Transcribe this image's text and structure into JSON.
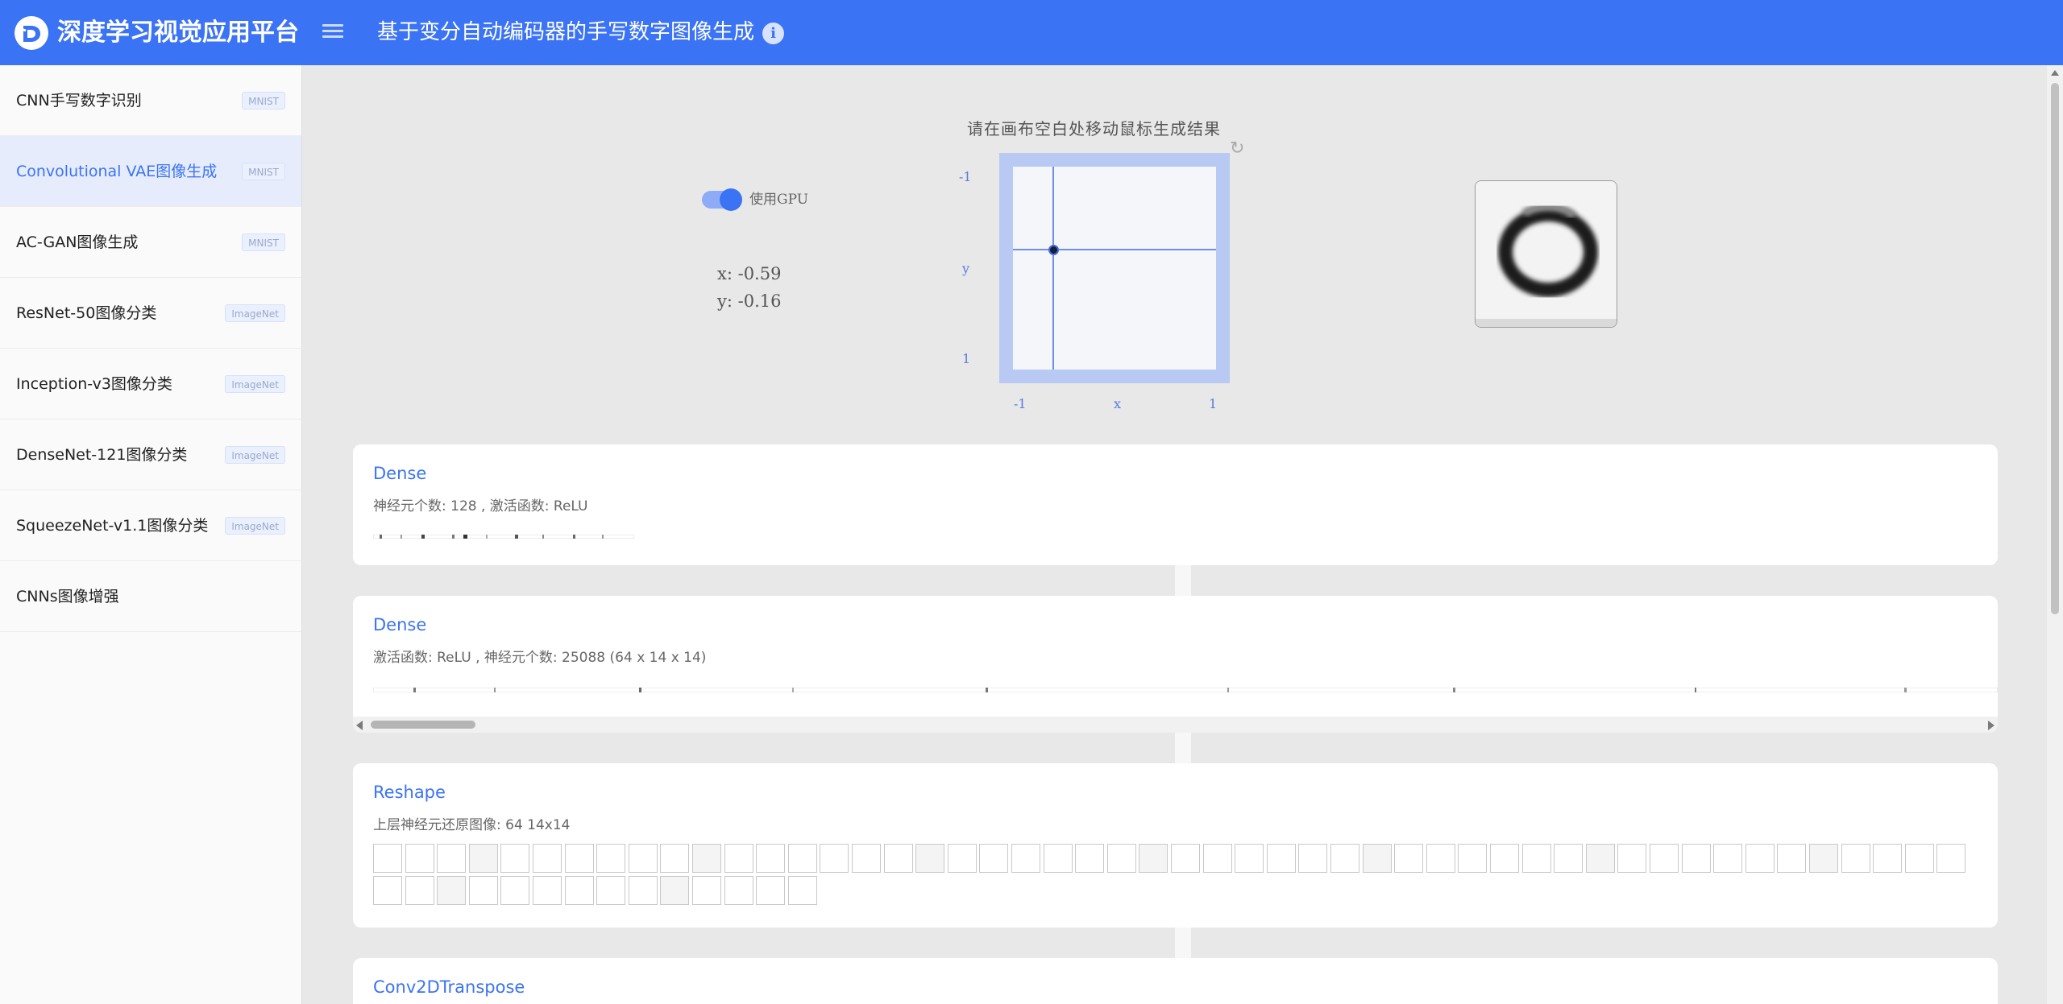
{
  "header": {
    "brand": "深度学习视觉应用平台",
    "title": "基于变分自动编码器的手写数字图像生成",
    "info_glyph": "i",
    "colors": {
      "primary": "#3b73f5"
    }
  },
  "sidebar": {
    "items": [
      {
        "label": "CNN手写数字识别",
        "tag": "MNIST",
        "active": false
      },
      {
        "label": "Convolutional VAE图像生成",
        "tag": "MNIST",
        "active": true
      },
      {
        "label": "AC-GAN图像生成",
        "tag": "MNIST",
        "active": false
      },
      {
        "label": "ResNet-50图像分类",
        "tag": "ImageNet",
        "active": false
      },
      {
        "label": "Inception-v3图像分类",
        "tag": "ImageNet",
        "active": false
      },
      {
        "label": "DenseNet-121图像分类",
        "tag": "ImageNet",
        "active": false
      },
      {
        "label": "SqueezeNet-v1.1图像分类",
        "tag": "ImageNet",
        "active": false
      },
      {
        "label": "CNNs图像增强",
        "tag": "",
        "active": false
      }
    ]
  },
  "control": {
    "hint": "请在画布空白处移动鼠标生成结果",
    "gpu_label": "使用GPU",
    "gpu_enabled": true,
    "x_text": "x: -0.59",
    "y_text": "y: -0.16",
    "x_value": -0.59,
    "y_value": -0.16,
    "axis": {
      "y_top": "-1",
      "y_mid": "y",
      "y_bottom": "1",
      "x_left": "-1",
      "x_mid": "x",
      "x_right": "1"
    }
  },
  "layers": [
    {
      "name": "Dense",
      "desc": "神经元个数: 128 , 激活函数:  ReLU"
    },
    {
      "name": "Dense",
      "desc": "激活函数: ReLU , 神经元个数: 25088 (64 x 14 x 14)"
    },
    {
      "name": "Reshape",
      "desc": "上层神经元还原图像: 64 14x14",
      "feature_maps": 64
    },
    {
      "name": "Conv2DTranspose"
    }
  ]
}
